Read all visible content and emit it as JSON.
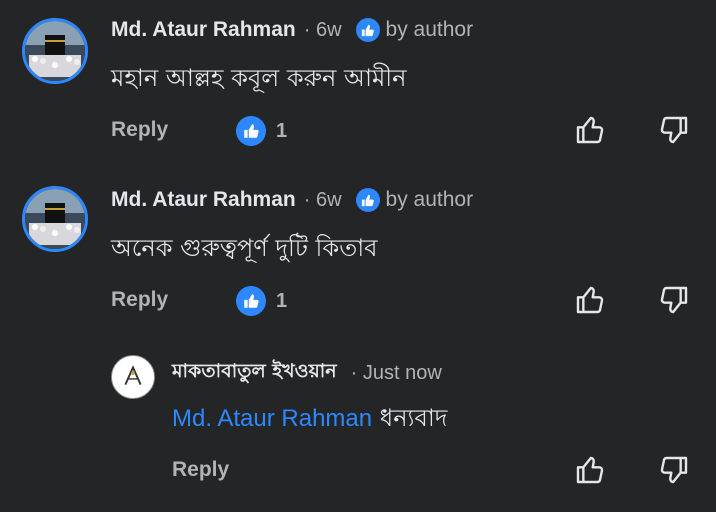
{
  "comments": [
    {
      "author": "Md. Ataur Rahman",
      "time": "· 6w",
      "badge": "by author",
      "text": "মহান আল্লহ কবূল করুন আমীন",
      "reply_label": "Reply",
      "likes": "1"
    },
    {
      "author": "Md. Ataur Rahman",
      "time": "· 6w",
      "badge": "by author",
      "text": "অনেক গুরুত্বপূর্ণ দুটি কিতাব",
      "reply_label": "Reply",
      "likes": "1"
    }
  ],
  "reply": {
    "author": "মাকতাবাতুল ইখওয়ান",
    "time": "· Just now",
    "mention": "Md. Ataur Rahman",
    "text": "ধন্যবাদ",
    "reply_label": "Reply"
  },
  "colors": {
    "background": "#242526",
    "accent": "#2d88ff",
    "secondary_text": "#b0b3b8"
  },
  "icons": [
    "thumbs-up-icon",
    "thumbs-down-icon",
    "like-reaction-icon"
  ]
}
